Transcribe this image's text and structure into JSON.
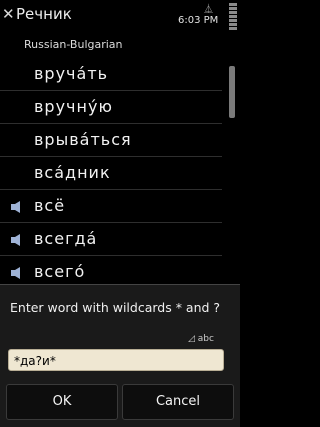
{
  "statusbar": {
    "app_title": "Речник",
    "time": "6:03 PM"
  },
  "subtitle": "Russian-Bulgarian",
  "list": {
    "items": [
      {
        "word": "вручáть",
        "audio": false
      },
      {
        "word": "вручнýю",
        "audio": false
      },
      {
        "word": "врывáться",
        "audio": false
      },
      {
        "word": "всáдник",
        "audio": false
      },
      {
        "word": "всё",
        "audio": true
      },
      {
        "word": "всегдá",
        "audio": true
      },
      {
        "word": "всегó",
        "audio": true
      }
    ]
  },
  "dialog": {
    "prompt": "Enter word with wildcards * and ?",
    "input_mode": "abc",
    "input_value": "*да?и*",
    "ok_label": "OK",
    "cancel_label": "Cancel"
  },
  "colors": {
    "background": "#000000",
    "input_background": "#efe7d2"
  }
}
